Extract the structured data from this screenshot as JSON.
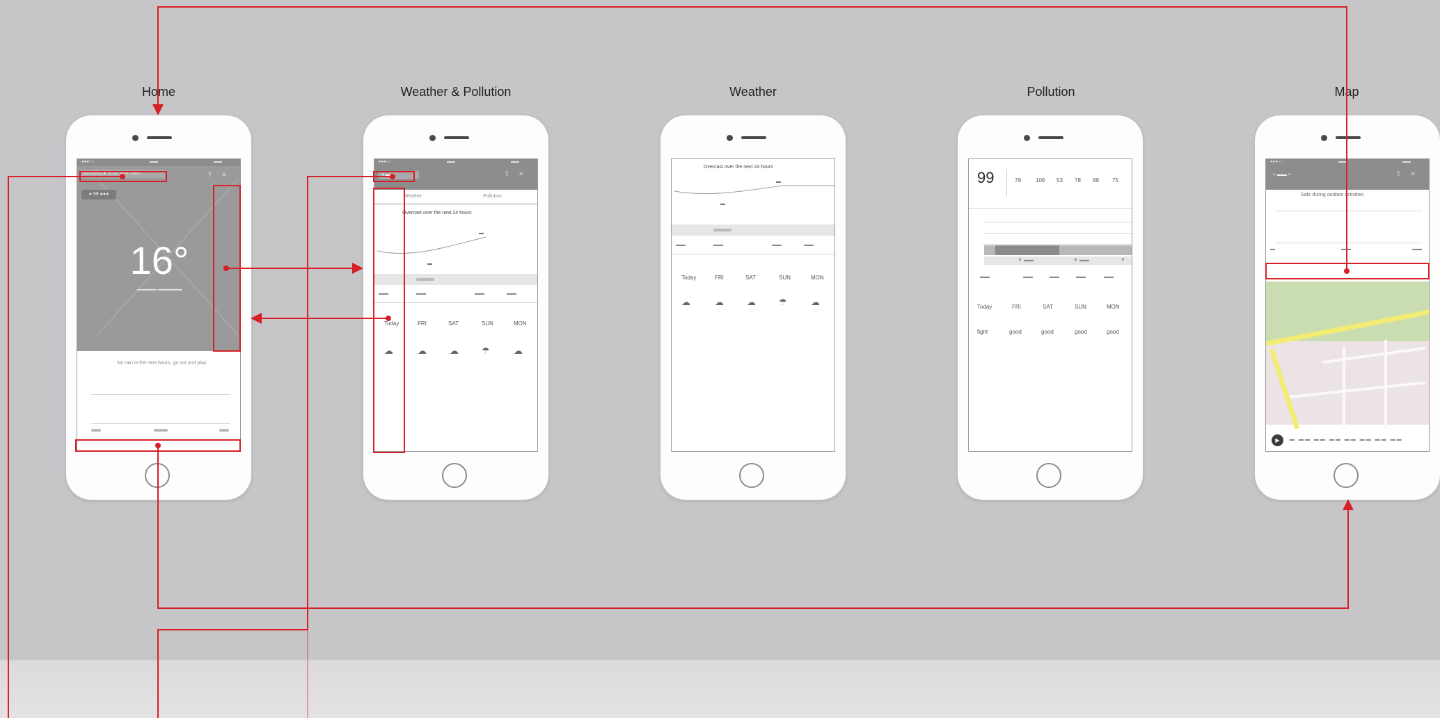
{
  "screens": [
    {
      "id": "home",
      "title": "Home"
    },
    {
      "id": "weather-pollution",
      "title": "Weather & Pollution"
    },
    {
      "id": "weather",
      "title": "Weather"
    },
    {
      "id": "pollution",
      "title": "Pollution"
    },
    {
      "id": "map",
      "title": "Map"
    }
  ],
  "home": {
    "temperature": "16°",
    "location_pill": "Merdeka ● Shan Mon Mun",
    "badge": "● 99 ●●●",
    "message": "No rain in the next hours, go out and play."
  },
  "weather_pollution": {
    "tab_weather": "Weather",
    "tab_pollution": "Pollution",
    "chart_title": "Overcast over the next 24 hours",
    "days": [
      "Today",
      "FRI",
      "SAT",
      "SUN",
      "MON"
    ]
  },
  "weather": {
    "chart_title": "Overcast over the next 24 hours",
    "days": [
      "Today",
      "FRI",
      "SAT",
      "SUN",
      "MON"
    ]
  },
  "pollution": {
    "aqi": "99",
    "top_values": [
      "79",
      "106",
      "53",
      "78",
      "99",
      "75"
    ],
    "forecast_days": [
      "Today",
      "FRI",
      "SAT",
      "SUN",
      "MON"
    ],
    "forecast_levels": [
      "fight",
      "good",
      "good",
      "good",
      "good"
    ]
  },
  "map": {
    "banner": "Safe during outdoor activities"
  },
  "colors": {
    "background": "#c6c6c9",
    "flow_line": "#d61f26",
    "wireframe_gray": "#8d8d8d",
    "map_green": "#c9ddb0",
    "map_road": "#f3ec72"
  }
}
